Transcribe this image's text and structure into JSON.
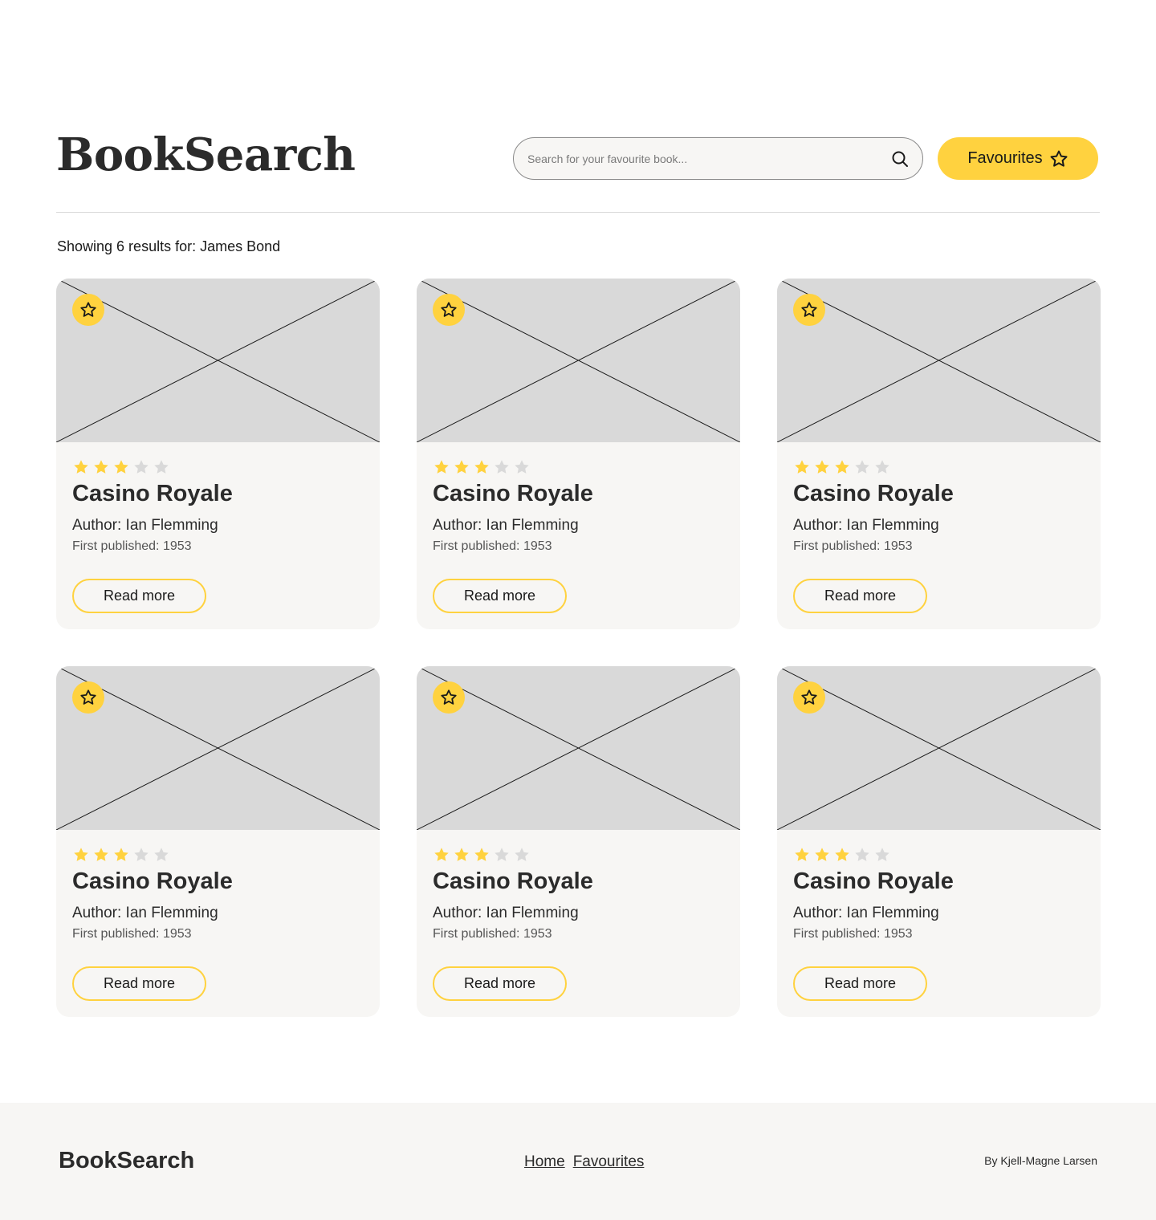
{
  "header": {
    "logo": "BookSearch",
    "search_placeholder": "Search for your favourite book...",
    "favourites_label": "Favourites"
  },
  "results_text": "Showing 6 results for: James Bond",
  "colors": {
    "accent": "#ffd23f",
    "card_bg": "#f7f6f4",
    "thumb_bg": "#d9d9d9",
    "star_off": "#d9d9d9"
  },
  "books": [
    {
      "title": "Casino Royale",
      "author": "Author: Ian Flemming",
      "published": "First published: 1953",
      "rating": 3,
      "max_rating": 5,
      "button": "Read more"
    },
    {
      "title": "Casino Royale",
      "author": "Author: Ian Flemming",
      "published": "First published: 1953",
      "rating": 3,
      "max_rating": 5,
      "button": "Read more"
    },
    {
      "title": "Casino Royale",
      "author": "Author: Ian Flemming",
      "published": "First published: 1953",
      "rating": 3,
      "max_rating": 5,
      "button": "Read more"
    },
    {
      "title": "Casino Royale",
      "author": "Author: Ian Flemming",
      "published": "First published: 1953",
      "rating": 3,
      "max_rating": 5,
      "button": "Read more"
    },
    {
      "title": "Casino Royale",
      "author": "Author: Ian Flemming",
      "published": "First published: 1953",
      "rating": 3,
      "max_rating": 5,
      "button": "Read more"
    },
    {
      "title": "Casino Royale",
      "author": "Author: Ian Flemming",
      "published": "First published: 1953",
      "rating": 3,
      "max_rating": 5,
      "button": "Read more"
    }
  ],
  "footer": {
    "logo": "BookSearch",
    "nav": [
      "Home",
      "Favourites"
    ],
    "credit": "By Kjell-Magne Larsen"
  }
}
